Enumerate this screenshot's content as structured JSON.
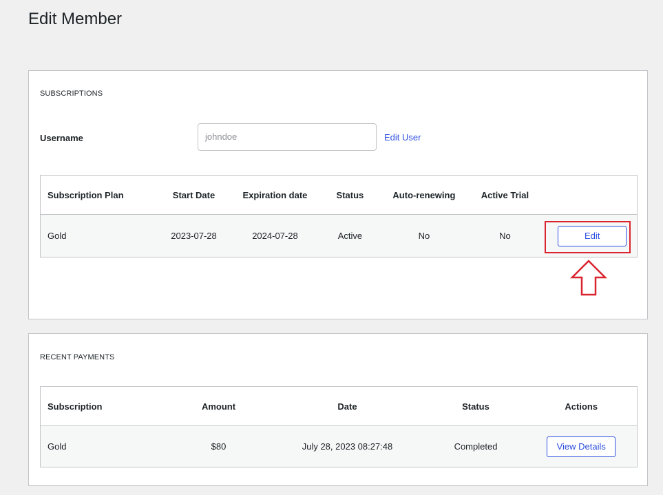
{
  "page": {
    "title": "Edit Member"
  },
  "subscriptions": {
    "section_title": "SUBSCRIPTIONS",
    "username_label": "Username",
    "username_placeholder": "johndoe",
    "edit_user_link": "Edit User",
    "columns": [
      "Subscription Plan",
      "Start Date",
      "Expiration date",
      "Status",
      "Auto-renewing",
      "Active Trial",
      ""
    ],
    "rows": [
      {
        "plan": "Gold",
        "start_date": "2023-07-28",
        "expiration_date": "2024-07-28",
        "status": "Active",
        "auto_renewing": "No",
        "active_trial": "No",
        "action_label": "Edit"
      }
    ]
  },
  "payments": {
    "section_title": "RECENT PAYMENTS",
    "columns": [
      "Subscription",
      "Amount",
      "Date",
      "Status",
      "Actions"
    ],
    "rows": [
      {
        "subscription": "Gold",
        "amount": "$80",
        "date": "July 28, 2023 08:27:48",
        "status": "Completed",
        "action_label": "View Details"
      }
    ]
  },
  "annotation": {
    "icon": "up-arrow-outline-icon",
    "color": "#d9232e"
  },
  "colors": {
    "accent": "#2c4ee0",
    "background": "#f0f0f1",
    "row_background": "#f6f7f7"
  }
}
